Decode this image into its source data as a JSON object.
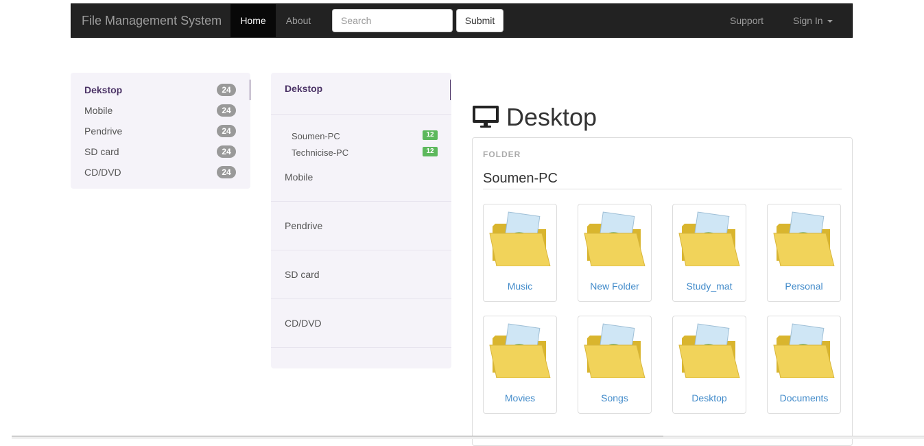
{
  "navbar": {
    "brand": "File Management System",
    "links": {
      "home": "Home",
      "about": "About",
      "support": "Support",
      "signin": "Sign In"
    },
    "search_placeholder": "Search",
    "submit_label": "Submit"
  },
  "sidebar_left": {
    "items": [
      {
        "label": "Dekstop",
        "count": "24"
      },
      {
        "label": "Mobile",
        "count": "24"
      },
      {
        "label": "Pendrive",
        "count": "24"
      },
      {
        "label": "SD card",
        "count": "24"
      },
      {
        "label": "CD/DVD",
        "count": "24"
      }
    ]
  },
  "sidebar_mid": {
    "active": "Dekstop",
    "subitems": [
      {
        "label": "Soumen-PC",
        "count": "12"
      },
      {
        "label": "Technicise-PC",
        "count": "12"
      }
    ],
    "items": [
      "Mobile",
      "Pendrive",
      "SD card",
      "CD/DVD"
    ]
  },
  "main": {
    "title": "Desktop",
    "title_icon": "desktop-monitor-icon",
    "section_label": "FOLDER",
    "computer_name": "Soumen-PC",
    "folders": [
      "Music",
      "New Folder",
      "Study_mat",
      "Personal",
      "Movies",
      "Songs",
      "Desktop",
      "Documents"
    ],
    "folder_icon": "folder-with-picture-icon"
  },
  "colors": {
    "navbar_bg": "#222222",
    "panel_bg": "#f5f3f9",
    "active_text": "#4b3366",
    "link_blue": "#428bca",
    "badge_green": "#5cb85c"
  }
}
